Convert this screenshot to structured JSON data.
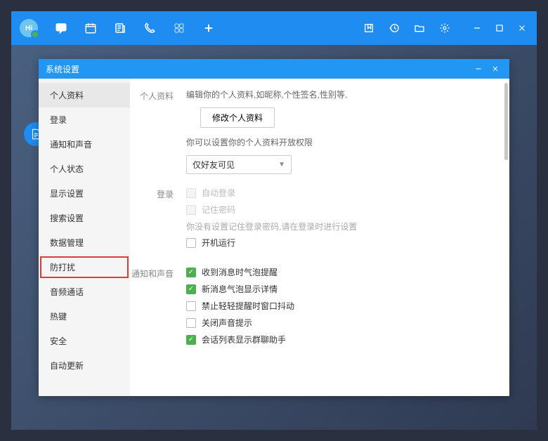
{
  "dialog": {
    "title": "系统设置",
    "sidebar": [
      {
        "id": "profile",
        "label": "个人资料",
        "selected": true,
        "highlighted": false
      },
      {
        "id": "login",
        "label": "登录",
        "selected": false,
        "highlighted": false
      },
      {
        "id": "notify",
        "label": "通知和声音",
        "selected": false,
        "highlighted": false
      },
      {
        "id": "status",
        "label": "个人状态",
        "selected": false,
        "highlighted": false
      },
      {
        "id": "display",
        "label": "显示设置",
        "selected": false,
        "highlighted": false
      },
      {
        "id": "search",
        "label": "搜索设置",
        "selected": false,
        "highlighted": false
      },
      {
        "id": "data",
        "label": "数据管理",
        "selected": false,
        "highlighted": false
      },
      {
        "id": "dnd",
        "label": "防打扰",
        "selected": false,
        "highlighted": true
      },
      {
        "id": "audio",
        "label": "音频通话",
        "selected": false,
        "highlighted": false
      },
      {
        "id": "hotkey",
        "label": "热键",
        "selected": false,
        "highlighted": false
      },
      {
        "id": "safe",
        "label": "安全",
        "selected": false,
        "highlighted": false
      },
      {
        "id": "update",
        "label": "自动更新",
        "selected": false,
        "highlighted": false
      }
    ],
    "sections": {
      "profile": {
        "title": "个人资料",
        "desc": "编辑你的个人资料,如昵称,个性签名,性别等.",
        "edit_btn": "修改个人资料",
        "privacy_desc": "你可以设置你的个人资料开放权限",
        "privacy_value": "仅好友可见"
      },
      "login": {
        "title": "登录",
        "auto_login": "自动登录",
        "remember_pwd": "记住密码",
        "note": "你没有设置记住登录密码,请在登录时进行设置",
        "startup": "开机运行"
      },
      "notification": {
        "title": "通知和声音",
        "opts": [
          {
            "label": "收到消息时气泡提醒",
            "checked": true
          },
          {
            "label": "新消息气泡显示详情",
            "checked": true
          },
          {
            "label": "禁止轻轻提醒时窗口抖动",
            "checked": false
          },
          {
            "label": "关闭声音提示",
            "checked": false
          },
          {
            "label": "会话列表显示群聊助手",
            "checked": true
          }
        ]
      }
    }
  }
}
